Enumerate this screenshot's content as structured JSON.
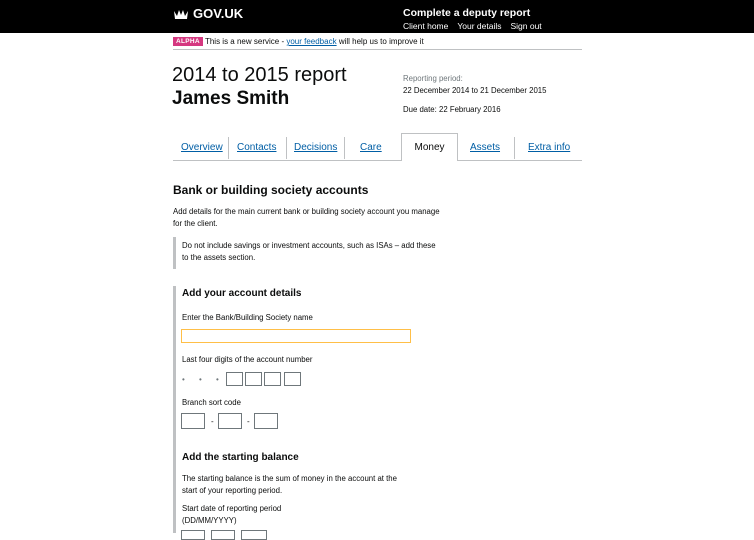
{
  "header": {
    "logo_text": "GOV.UK",
    "service_title": "Complete a deputy report",
    "links": [
      "Client home",
      "Your details",
      "Sign out"
    ]
  },
  "phase_banner": {
    "tag": "ALPHA",
    "text_before": "This is a new service - ",
    "link": "your feedback",
    "text_after": " will help us to improve it"
  },
  "report": {
    "title": "2014 to 2015 report",
    "client_name": "James Smith",
    "period_label": "Reporting period:",
    "period_value": "22 December 2014 to 21 December 2015",
    "due_date": "Due date: 22 February 2016"
  },
  "tabs": [
    "Overview",
    "Contacts",
    "Decisions",
    "Care",
    "Money",
    "Assets",
    "Extra info"
  ],
  "active_tab": "Money",
  "section": {
    "heading": "Bank or building society accounts",
    "intro_line1": "Add details for the main current bank or building society account you manage",
    "intro_line2": "for the client.",
    "inset_line1": "Do not include savings or investment accounts, such as ISAs – add these",
    "inset_line2": "to the assets section."
  },
  "form": {
    "account_heading": "Add your account details",
    "bank_name_label": "Enter the Bank/Building Society name",
    "bank_name_value": "",
    "account_digits_label": "Last four digits of the account number",
    "masked_digits": "• • • •",
    "sort_code_label": "Branch sort code",
    "sort_code_separator": "-",
    "balance_heading": "Add the starting balance",
    "balance_help_line1": "The starting balance is the sum of money in the account at the",
    "balance_help_line2": "start of your reporting period.",
    "start_date_label": "Start date of reporting period",
    "start_date_hint": "(DD/MM/YYYY)"
  }
}
